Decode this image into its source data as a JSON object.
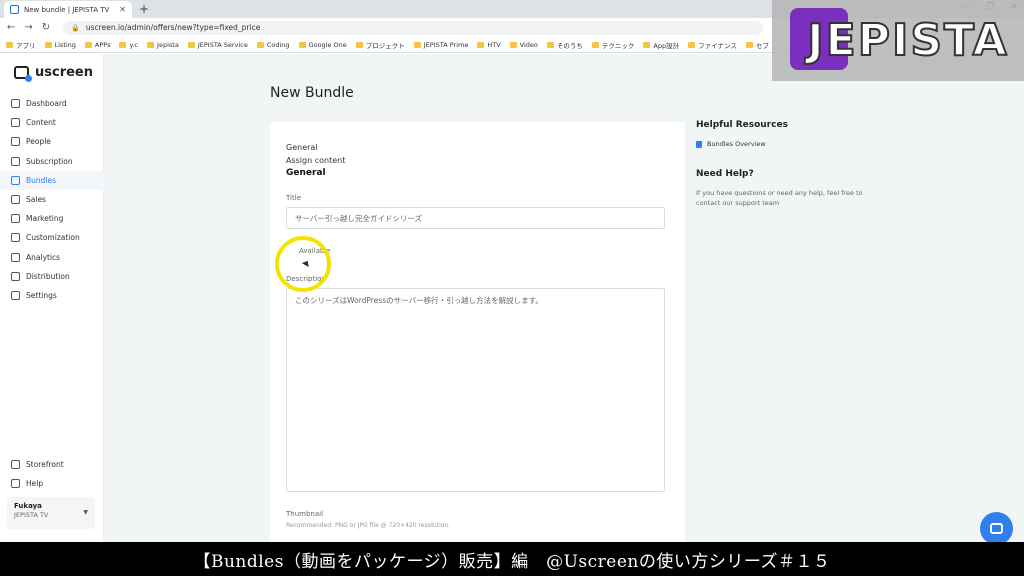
{
  "browser": {
    "tab_title": "New bundle | JEPISTA TV",
    "url": "uscreen.io/admin/offers/new?type=fixed_price",
    "bookmarks": [
      "アプリ",
      "Listing",
      "APPs",
      "y.c",
      "Jepista",
      "JEPISTA Service",
      "Coding",
      "Google One",
      "プロジェクト",
      "JEPISTA Prime",
      "HTV",
      "Video",
      "そのうち",
      "テクニック",
      "App設計",
      "ファイナンス",
      "セブ"
    ]
  },
  "overlay": {
    "logo_text": "JEPISTA"
  },
  "sidebar": {
    "brand": "uscreen",
    "items": [
      {
        "label": "Dashboard"
      },
      {
        "label": "Content"
      },
      {
        "label": "People"
      },
      {
        "label": "Subscription"
      },
      {
        "label": "Bundles"
      },
      {
        "label": "Sales"
      },
      {
        "label": "Marketing"
      },
      {
        "label": "Customization"
      },
      {
        "label": "Analytics"
      },
      {
        "label": "Distribution"
      },
      {
        "label": "Settings"
      }
    ],
    "bottom_items": [
      {
        "label": "Storefront"
      },
      {
        "label": "Help"
      }
    ],
    "account": {
      "name": "Fukaya",
      "org": "JEPISTA TV"
    }
  },
  "main": {
    "page_title": "New Bundle",
    "steps": [
      "General",
      "Assign content"
    ],
    "current_step": "General",
    "title_label": "Title",
    "title_value": "サーバー引っ越し完全ガイドシリーズ",
    "available_label": "Available",
    "description_label": "Description",
    "description_value": "このシリーズはWordPressのサーバー移行・引っ越し方法を解説します。",
    "thumbnail_label": "Thumbnail",
    "thumbnail_hint": "Recommended: PNG or JPG file @ 720×420 resolution."
  },
  "right_panel": {
    "resources_heading": "Helpful Resources",
    "resources_link": "Bundles Overview",
    "help_heading": "Need Help?",
    "help_text": "If you have questions or need any help, feel free to contact our support team"
  },
  "subtitle": "【Bundles（動画をパッケージ）販売】編　@Uscreenの使い方シリーズ＃１５",
  "colors": {
    "accent": "#2f80ed",
    "highlight": "#f2e400"
  }
}
